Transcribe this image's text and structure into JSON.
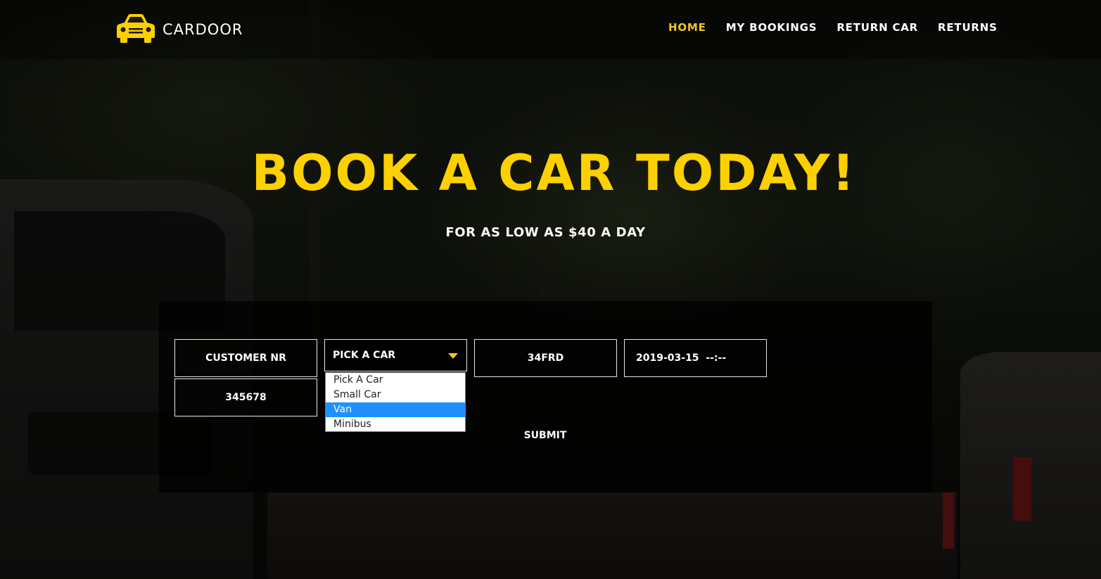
{
  "brand": {
    "name": "CARDOOR",
    "logo_icon": "car-icon",
    "accent": "#fdd000"
  },
  "nav": {
    "items": [
      {
        "label": "HOME",
        "active": true
      },
      {
        "label": "MY BOOKINGS",
        "active": false
      },
      {
        "label": "RETURN CAR",
        "active": false
      },
      {
        "label": "RETURNS",
        "active": false
      }
    ]
  },
  "hero": {
    "title": "BOOK A CAR TODAY!",
    "subtitle": "FOR AS LOW AS $40 A DAY"
  },
  "form": {
    "customer_nr_placeholder": "CUSTOMER NR",
    "customer_nr_value": "345678",
    "car_select": {
      "selected": "PICK A CAR",
      "options": [
        "Pick A Car",
        "Small Car",
        "Van",
        "Minibus"
      ],
      "highlighted": "Van"
    },
    "code_value": "34FRD",
    "datetime_value": "2019-03-15  --:--",
    "submit_label": "SUBMIT"
  },
  "colors": {
    "highlight": "#1e90ff",
    "panel": "#000000"
  }
}
